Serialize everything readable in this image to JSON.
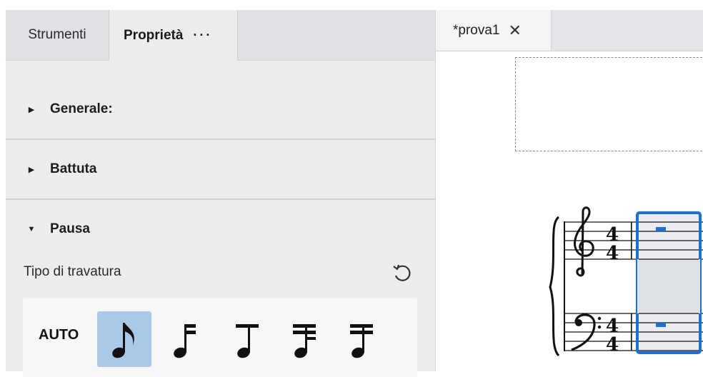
{
  "left_panel": {
    "tabs": [
      {
        "label": "Strumenti"
      },
      {
        "label": "Proprietà"
      }
    ],
    "more_label": "···",
    "sections": [
      {
        "label": "Generale:",
        "expanded": false
      },
      {
        "label": "Battuta",
        "expanded": false
      },
      {
        "label": "Pausa",
        "expanded": true
      }
    ],
    "beam_type_label": "Tipo di travatura",
    "beam_options": {
      "auto_label": "AUTO",
      "selected_index": 0
    }
  },
  "score_tab": {
    "label": "*prova1",
    "close_symbol": "✕"
  },
  "colors": {
    "selection": "#1f6fd0",
    "selected_button": "#aac8e8"
  }
}
